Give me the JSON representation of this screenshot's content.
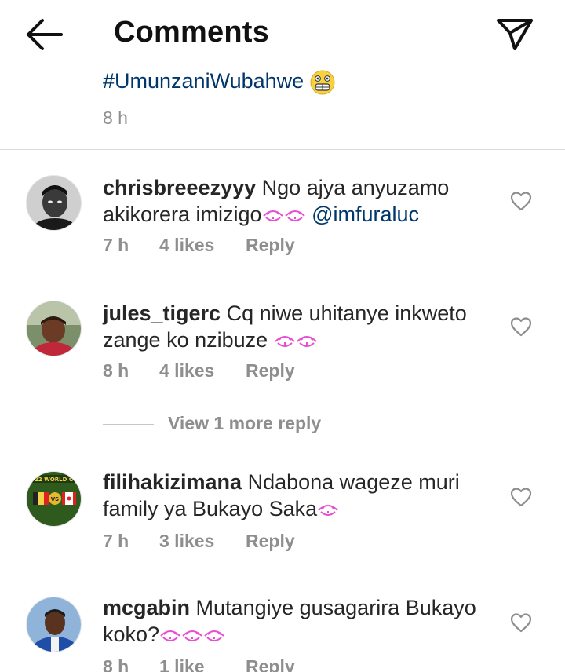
{
  "header": {
    "title": "Comments",
    "back_icon": "arrow-left-icon",
    "share_icon": "paper-plane-icon"
  },
  "caption": {
    "hashtag": "#UmunzaniWubahwe",
    "emoji": "grimacing-face-emoji",
    "time": "8 h"
  },
  "comments": [
    {
      "username": "chrisbreeezyyy",
      "text": "Ngo ajya anyuzamo akikorera imizigo",
      "emojis": "two-pink-face-emojis",
      "mention": "@imfuraluc",
      "time": "7 h",
      "likes": "4 likes",
      "reply": "Reply"
    },
    {
      "username": "jules_tigerc",
      "text": "Cq niwe uhitanye inkweto zange ko nzibuze",
      "emojis": "two-pink-face-emojis",
      "time": "8 h",
      "likes": "4 likes",
      "reply": "Reply"
    },
    {
      "username": "filihakizimana",
      "text": "Ndabona wageze muri family ya Bukayo Saka",
      "emojis": "one-pink-face-emoji",
      "time": "7 h",
      "likes": "3 likes",
      "reply": "Reply"
    },
    {
      "username": "mcgabin",
      "text": "Mutangiye gusagarira Bukayo koko?",
      "emojis": "three-pink-face-emojis",
      "time": "8 h",
      "likes": "1 like",
      "reply": "Reply"
    }
  ],
  "view_more": "View 1 more reply",
  "colors": {
    "mention": "#00376b",
    "meta": "#8e8e8e",
    "text": "#262626",
    "emoji_pink": "#e84fd0",
    "emoji_yellow": "#f7d23e"
  }
}
